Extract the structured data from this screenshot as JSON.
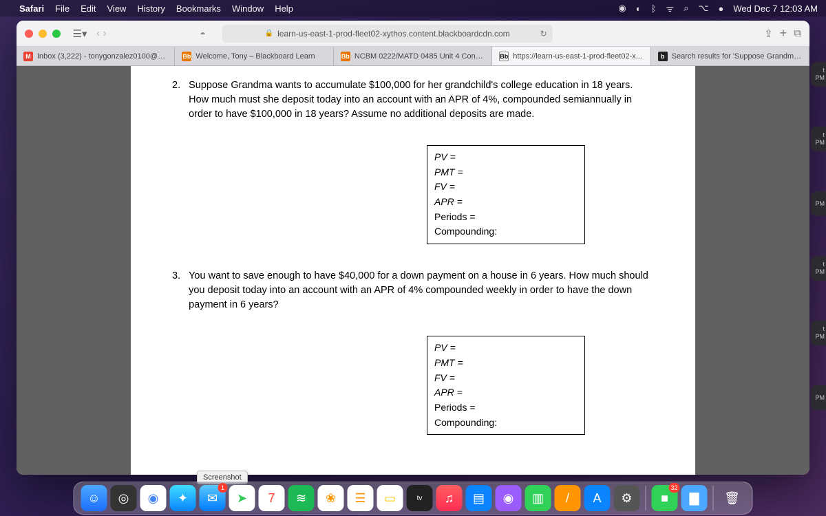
{
  "menubar": {
    "app": "Safari",
    "items": [
      "File",
      "Edit",
      "View",
      "History",
      "Bookmarks",
      "Window",
      "Help"
    ],
    "clock": "Wed Dec 7  12:03 AM"
  },
  "browser": {
    "address": "learn-us-east-1-prod-fleet02-xythos.content.blackboardcdn.com",
    "tabs": [
      {
        "favicon_bg": "#ea4335",
        "favicon_txt": "M",
        "label": "Inbox (3,222) - tonygonzalez0100@g..."
      },
      {
        "favicon_bg": "#e87500",
        "favicon_txt": "Bb",
        "label": "Welcome, Tony – Blackboard Learn"
      },
      {
        "favicon_bg": "#e87500",
        "favicon_txt": "Bb",
        "label": "NCBM 0222/MATD 0485 Unit 4 Conte..."
      },
      {
        "favicon_bg": "#ffffff",
        "favicon_txt": "Bb",
        "label": "https://learn-us-east-1-prod-fleet02-x...",
        "fcolor": "#000",
        "border": "1"
      },
      {
        "favicon_bg": "#222222",
        "favicon_txt": "b",
        "label": "Search results for 'Suppose Grandma..."
      }
    ],
    "active_tab": 3
  },
  "document": {
    "questions": [
      {
        "num": "2.",
        "text": "Suppose Grandma wants to accumulate $100,000 for her grandchild's college education in 18 years. How much must she deposit today into an account with an APR of 4%, compounded semiannually in order to have $100,000 in 18 years? Assume no additional deposits are made.",
        "vars": [
          "PV =",
          "PMT =",
          "FV =",
          "APR =",
          "Periods =",
          "Compounding:"
        ]
      },
      {
        "num": "3.",
        "text": "You want to save enough to have $40,000 for a down payment on a house in 6 years. How much should you deposit today into an account with an APR of 4% compounded weekly in order to have the down payment in 6 years?",
        "vars": [
          "PV =",
          "PMT =",
          "FV =",
          "APR =",
          "Periods =",
          "Compounding:"
        ]
      }
    ]
  },
  "tooltip": "Screenshot",
  "dock": {
    "icons": [
      {
        "name": "finder",
        "bg": "linear-gradient(#4aa8ff,#1e6fff)",
        "glyph": "☺"
      },
      {
        "name": "screenshot",
        "bg": "#333",
        "glyph": "◎"
      },
      {
        "name": "chrome",
        "bg": "#fff",
        "glyph": "◉",
        "color": "#4285f4"
      },
      {
        "name": "safari",
        "bg": "linear-gradient(#3ddcff,#0a84ff)",
        "glyph": "✦"
      },
      {
        "name": "mail",
        "bg": "linear-gradient(#5ac8fa,#007aff)",
        "glyph": "✉",
        "badge": "1"
      },
      {
        "name": "maps",
        "bg": "#fff",
        "glyph": "➤",
        "color": "#34c759"
      },
      {
        "name": "calendar",
        "bg": "#fff",
        "glyph": "7",
        "color": "#ff3b30"
      },
      {
        "name": "spotify",
        "bg": "#1db954",
        "glyph": "≋"
      },
      {
        "name": "photos",
        "bg": "#fff",
        "glyph": "❀",
        "color": "#ff9500"
      },
      {
        "name": "reminders",
        "bg": "#fff",
        "glyph": "☰",
        "color": "#ff9500"
      },
      {
        "name": "notes",
        "bg": "#fff",
        "glyph": "▭",
        "color": "#ffcc00"
      },
      {
        "name": "appletv",
        "bg": "#222",
        "glyph": "tv",
        "fontsize": "10px"
      },
      {
        "name": "music",
        "bg": "linear-gradient(#ff5e5e,#ff2d55)",
        "glyph": "♫"
      },
      {
        "name": "keynote",
        "bg": "#0a84ff",
        "glyph": "▤"
      },
      {
        "name": "podcasts",
        "bg": "#9a5cff",
        "glyph": "◉"
      },
      {
        "name": "numbers",
        "bg": "#30d158",
        "glyph": "▥"
      },
      {
        "name": "pixelmator",
        "bg": "#ff9500",
        "glyph": "/"
      },
      {
        "name": "appstore",
        "bg": "#0a84ff",
        "glyph": "A"
      },
      {
        "name": "settings",
        "bg": "#555",
        "glyph": "⚙"
      }
    ],
    "separator_before_right": true,
    "right_icons": [
      {
        "name": "facetime",
        "bg": "#30d158",
        "glyph": "■",
        "badge": "32"
      },
      {
        "name": "folder",
        "bg": "#4aa8ff",
        "glyph": "▇"
      }
    ],
    "trash": {
      "name": "trash",
      "bg": "transparent",
      "glyph": "🗑"
    }
  },
  "notif_labels": [
    {
      "t": "t",
      "b": "PM"
    },
    {
      "t": "t",
      "b": "PM"
    },
    {
      "t": "",
      "b": "PM"
    },
    {
      "t": "t",
      "b": "PM"
    },
    {
      "t": "t",
      "b": "PM"
    },
    {
      "t": "",
      "b": "PM"
    }
  ]
}
